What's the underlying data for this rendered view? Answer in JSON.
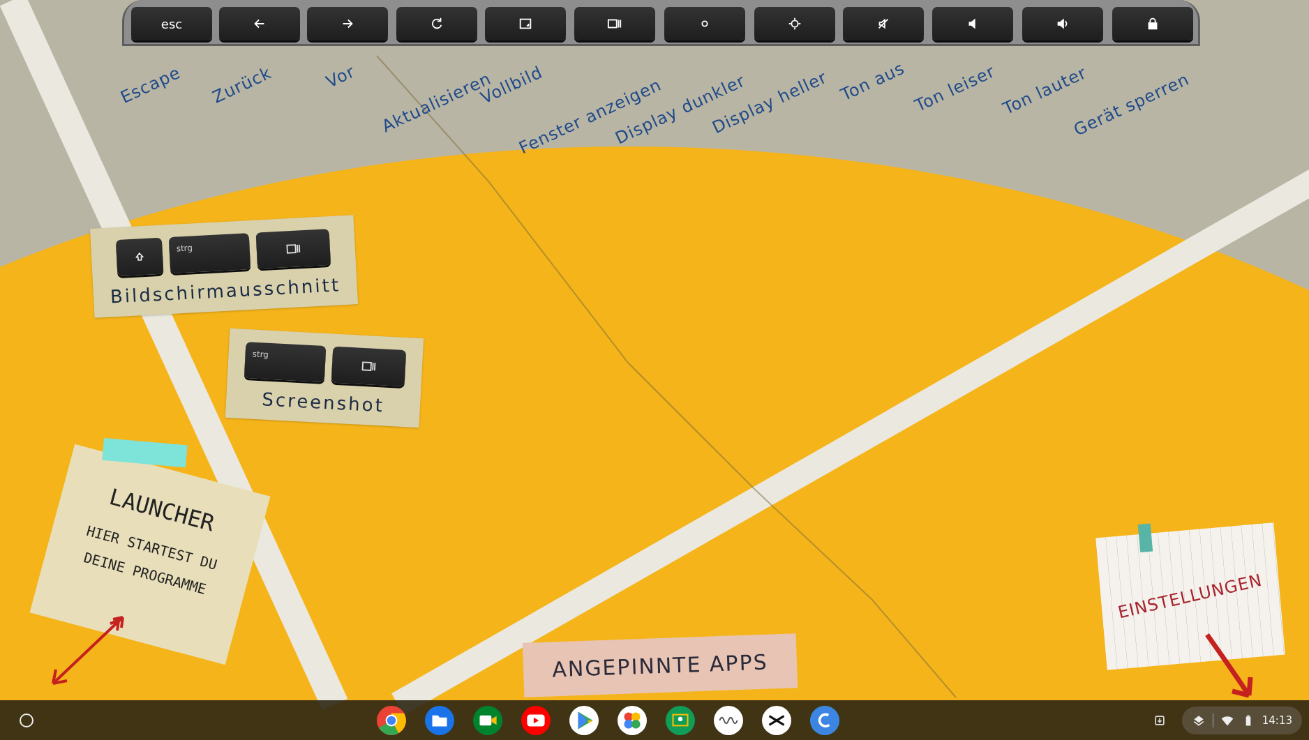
{
  "keyboard_strip": {
    "keys": [
      {
        "kind": "esc",
        "text": "esc",
        "caption": "Escape"
      },
      {
        "kind": "back",
        "caption": "Zurück"
      },
      {
        "kind": "forward",
        "caption": "Vor"
      },
      {
        "kind": "refresh",
        "caption": "Aktualisieren"
      },
      {
        "kind": "fullscreen",
        "caption": "Vollbild"
      },
      {
        "kind": "overview",
        "caption": "Fenster anzeigen"
      },
      {
        "kind": "dim",
        "caption": "Display dunkler"
      },
      {
        "kind": "bright",
        "caption": "Display heller"
      },
      {
        "kind": "mute",
        "caption": "Ton aus"
      },
      {
        "kind": "voldown",
        "caption": "Ton leiser"
      },
      {
        "kind": "volup",
        "caption": "Ton lauter"
      },
      {
        "kind": "lock",
        "caption": "Gerät sperren"
      }
    ]
  },
  "shortcut_notes": [
    {
      "keys": [
        {
          "kind": "shift"
        },
        {
          "kind": "ctrl",
          "text": "strg"
        },
        {
          "kind": "overview"
        }
      ],
      "caption": "Bildschirmausschnitt"
    },
    {
      "keys": [
        {
          "kind": "ctrl",
          "text": "strg"
        },
        {
          "kind": "overview"
        }
      ],
      "caption": "Screenshot"
    }
  ],
  "launcher_note": {
    "title": "LAUNCHER",
    "text": "HIER STARTEST DU DEINE PROGRAMME"
  },
  "pinned_note": {
    "text": "ANGEPINNTE APPS"
  },
  "settings_note": {
    "text": "EINSTELLUNGEN"
  },
  "shelf": {
    "apps": [
      {
        "kind": "chrome"
      },
      {
        "kind": "files"
      },
      {
        "kind": "meet"
      },
      {
        "kind": "youtube"
      },
      {
        "kind": "play"
      },
      {
        "kind": "photos"
      },
      {
        "kind": "classroom"
      },
      {
        "kind": "wave"
      },
      {
        "kind": "capcut"
      },
      {
        "kind": "canva"
      }
    ],
    "time": "14:13"
  }
}
